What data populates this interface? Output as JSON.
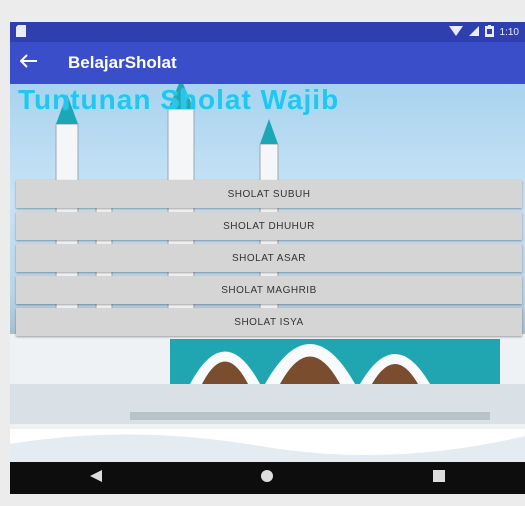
{
  "status_bar": {
    "time": "1:10",
    "icons": [
      "sd-card-icon",
      "wifi-icon",
      "signal-icon",
      "battery-icon"
    ]
  },
  "app_bar": {
    "title": "BelajarSholat",
    "back_icon": "back-arrow-icon"
  },
  "content": {
    "headline": "Tuntunan Sholat Wajib",
    "buttons": [
      {
        "label": "SHOLAT SUBUH"
      },
      {
        "label": "SHOLAT DHUHUR"
      },
      {
        "label": "SHOLAT ASAR"
      },
      {
        "label": "SHOLAT MAGHRIB"
      },
      {
        "label": "SHOLAT ISYA"
      }
    ]
  },
  "nav_bar": {
    "items": [
      "back-triangle-icon",
      "home-circle-icon",
      "recent-square-icon"
    ]
  },
  "colors": {
    "appbar": "#3a4ec9",
    "statusbar": "#2f3fb0",
    "headline": "#22c6f0",
    "button_bg": "#d5d5d5"
  }
}
